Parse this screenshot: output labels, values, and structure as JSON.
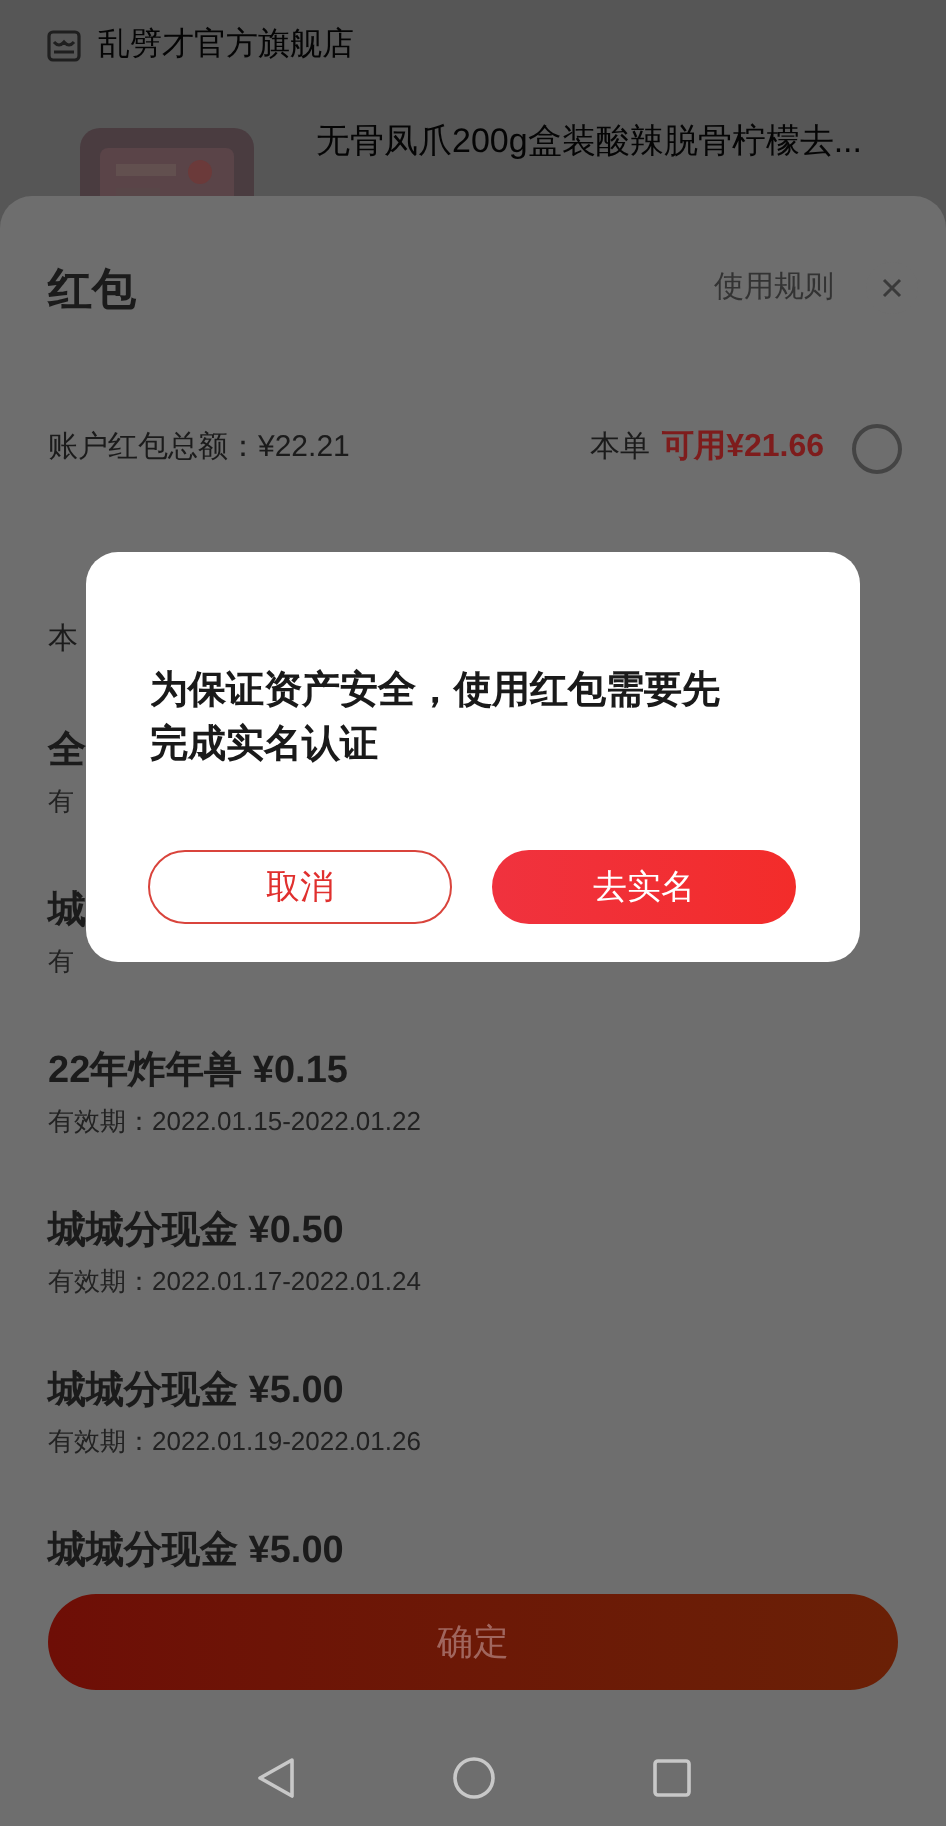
{
  "store": {
    "name": "乱劈才官方旗舰店"
  },
  "product": {
    "title": "无骨凤爪200g盒装酸辣脱骨柠檬去..."
  },
  "sheet": {
    "title": "红包",
    "rules_link": "使用规则",
    "balance": "账户红包总额：¥22.21",
    "order_label": "本单",
    "available": "可用¥21.66",
    "selected": false
  },
  "packets": [
    {
      "kind": "header",
      "title": "本"
    },
    {
      "kind": "item",
      "title": "全",
      "validity": "有"
    },
    {
      "kind": "item",
      "title": "城",
      "validity": "有"
    },
    {
      "kind": "item",
      "title": "22年炸年兽 ¥0.15",
      "validity": "有效期：2022.01.15-2022.01.22"
    },
    {
      "kind": "item",
      "title": "城城分现金 ¥0.50",
      "validity": "有效期：2022.01.17-2022.01.24"
    },
    {
      "kind": "item",
      "title": "城城分现金 ¥5.00",
      "validity": "有效期：2022.01.19-2022.01.26"
    },
    {
      "kind": "item",
      "title": "城城分现金 ¥5.00"
    }
  ],
  "confirm_button": "确定",
  "dialog": {
    "message": "为保证资产安全，使用红包需要先完成实名认证",
    "buttons": [
      {
        "kind": "secondary",
        "label": "取消"
      },
      {
        "kind": "primary",
        "label": "去实名"
      }
    ]
  }
}
